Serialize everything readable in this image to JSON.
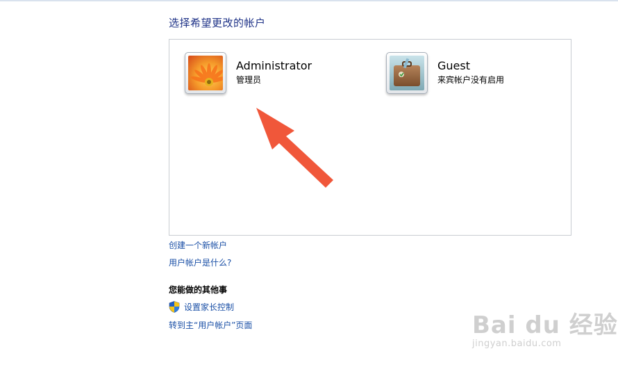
{
  "header": {
    "title": "选择希望更改的帐户"
  },
  "accounts": [
    {
      "name": "Administrator",
      "role": "管理员",
      "icon": "flower-avatar-icon"
    },
    {
      "name": "Guest",
      "role": "来宾帐户没有启用",
      "icon": "briefcase-avatar-icon"
    }
  ],
  "links": {
    "create_account": "创建一个新帐户",
    "what_is_account": "用户帐户是什么?"
  },
  "other_tasks": {
    "heading": "您能做的其他事",
    "parental_controls": "设置家长控制",
    "goto_main": "转到主“用户帐户”页面"
  },
  "annotation": {
    "arrow_color": "#f0573a"
  },
  "watermark": {
    "brand": "Bai  du 经验",
    "site": "jingyan.baidu.com"
  }
}
